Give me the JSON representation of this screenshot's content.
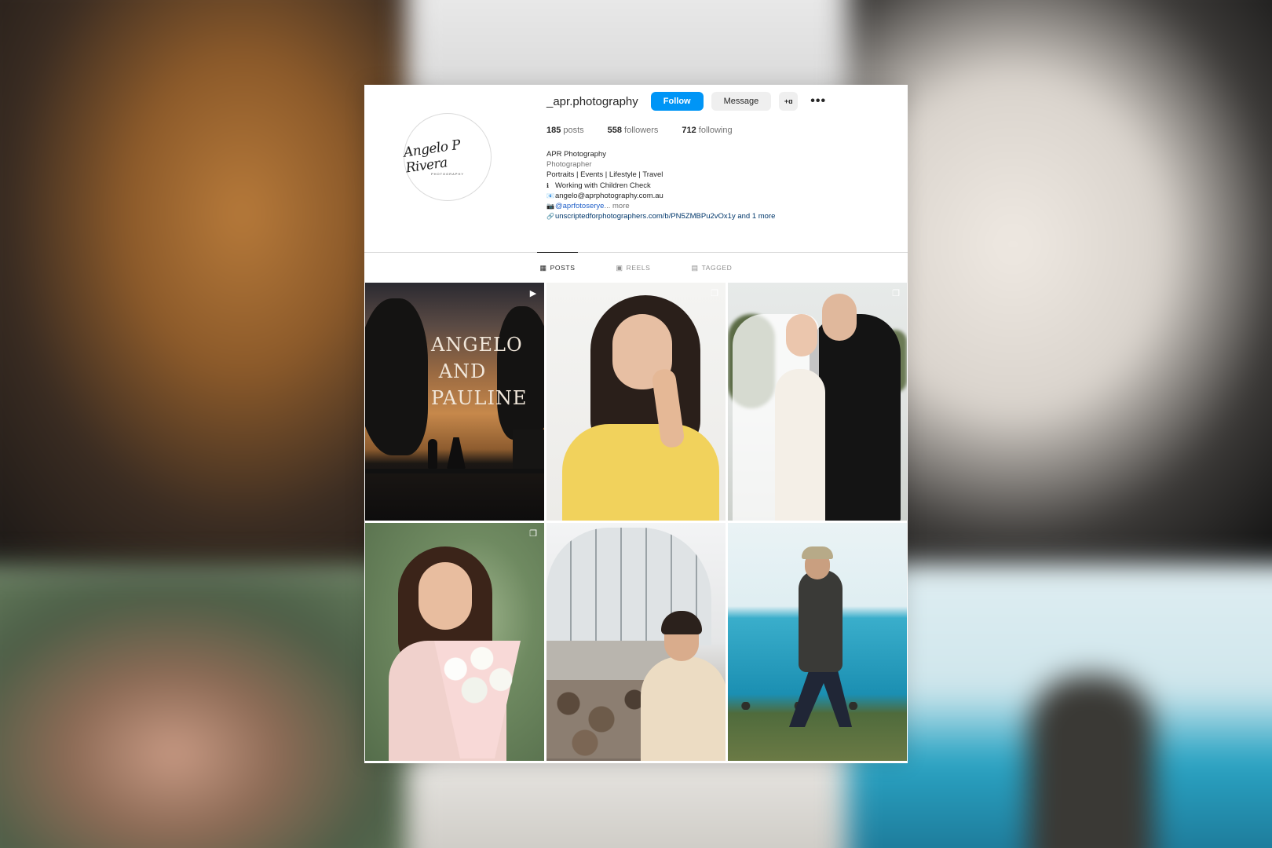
{
  "profile": {
    "username": "_apr.photography",
    "avatar_script": "Angelo P Rivera",
    "avatar_sub": "PHOTOGRAPHY",
    "buttons": {
      "follow": "Follow",
      "message": "Message",
      "suggest": "+ɑ"
    },
    "more": "•••",
    "stats": {
      "posts_count": "185",
      "posts_label": "posts",
      "followers_count": "558",
      "followers_label": "followers",
      "following_count": "712",
      "following_label": "following"
    },
    "bio": {
      "name": "APR Photography",
      "category": "Photographer",
      "line1": "Portraits | Events | Lifestyle | Travel",
      "line2_icon": "ℹ",
      "line2": "Working with Children Check",
      "line3_icon": "📧",
      "line3": "angelo@aprphotography.com.au",
      "line4_icon": "📷",
      "line4_handle": "@aprfotoserye",
      "line4_more": "... more",
      "link_icon": "🔗",
      "link": "unscriptedforphotographers.com/b/PN5ZMBPu2vOx1y and 1 more"
    }
  },
  "tabs": [
    {
      "label": "POSTS",
      "icon": "grid-icon",
      "glyph": "▦"
    },
    {
      "label": "REELS",
      "icon": "reels-icon",
      "glyph": "▣"
    },
    {
      "label": "TAGGED",
      "icon": "tagged-icon",
      "glyph": "▤"
    }
  ],
  "posts": [
    {
      "type": "reel",
      "overlay_text": [
        "ANGELO",
        "AND",
        "PAULINE"
      ],
      "type_glyph": "▶"
    },
    {
      "type": "carousel",
      "type_glyph": "❐"
    },
    {
      "type": "carousel",
      "type_glyph": "❐"
    },
    {
      "type": "carousel",
      "type_glyph": "❐"
    },
    {
      "type": "photo",
      "type_glyph": ""
    },
    {
      "type": "photo",
      "type_glyph": ""
    }
  ],
  "colors": {
    "follow_blue": "#0095f6",
    "link_blue": "#00376b",
    "text": "#262626",
    "muted": "#737373"
  }
}
